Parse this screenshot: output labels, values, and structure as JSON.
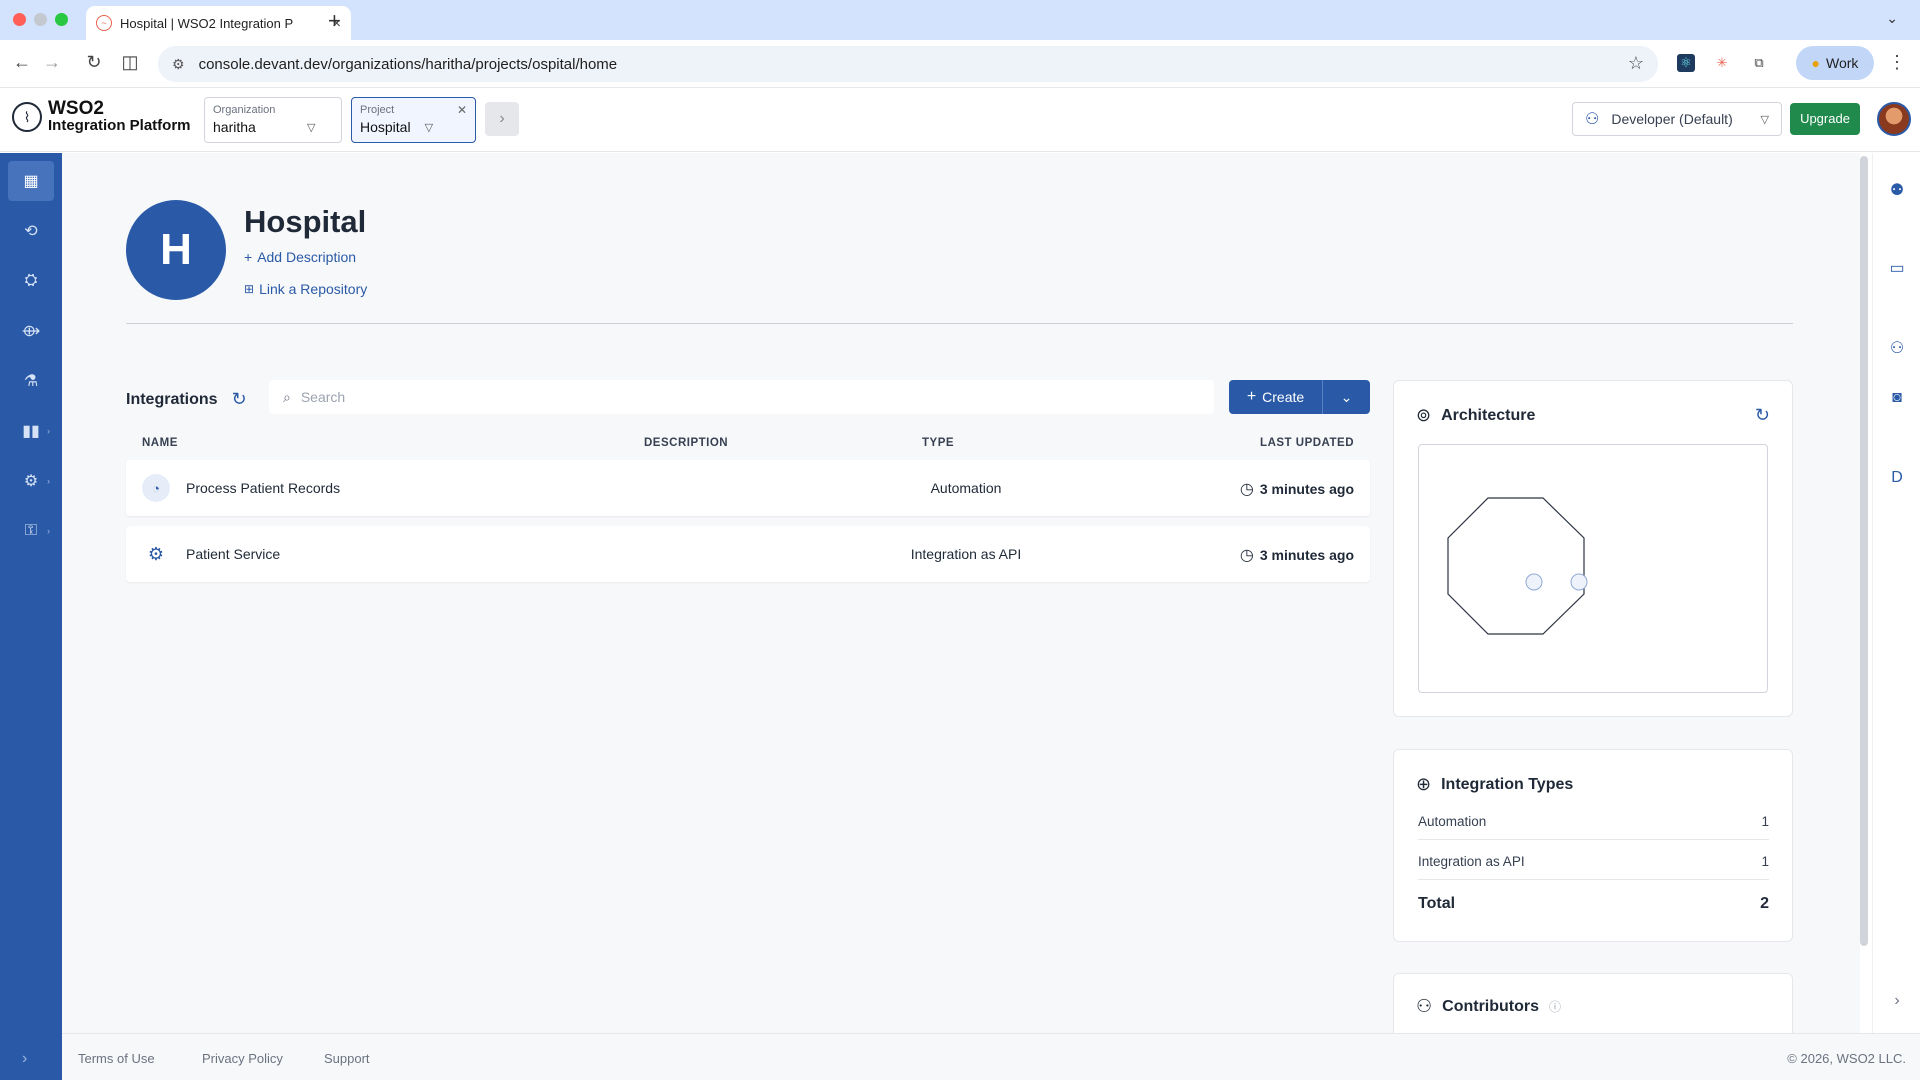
{
  "browser": {
    "tab_title": "Hospital | WSO2 Integration P",
    "url": "console.devant.dev/organizations/haritha/projects/ospital/home",
    "profile_label": "Work"
  },
  "header": {
    "logo_line1": "WSO2",
    "logo_line2": "Integration Platform",
    "org_label": "Organization",
    "org_value": "haritha",
    "project_label": "Project",
    "project_value": "Hospital",
    "environment": "Developer (Default)",
    "upgrade_label": "Upgrade"
  },
  "project": {
    "initial": "H",
    "title": "Hospital",
    "add_description": "Add Description",
    "link_repository": "Link a Repository"
  },
  "integrations": {
    "label": "Integrations",
    "search_placeholder": "Search",
    "create_label": "Create",
    "columns": [
      "NAME",
      "DESCRIPTION",
      "TYPE",
      "LAST UPDATED"
    ],
    "rows": [
      {
        "name": "Process Patient Records",
        "description": "",
        "type": "Automation",
        "updated": "3 minutes ago"
      },
      {
        "name": "Patient Service",
        "description": "",
        "type": "Integration as API",
        "updated": "3 minutes ago"
      }
    ]
  },
  "architecture": {
    "title": "Architecture"
  },
  "integration_types": {
    "title": "Integration Types",
    "rows": [
      {
        "label": "Automation",
        "count": "1"
      },
      {
        "label": "Integration as API",
        "count": "1"
      }
    ],
    "total_label": "Total",
    "total_count": "2"
  },
  "contributors": {
    "title": "Contributors"
  },
  "footer": {
    "terms": "Terms of Use",
    "privacy": "Privacy Policy",
    "support": "Support",
    "copyright": "© 2026, WSO2 LLC."
  },
  "colors": {
    "primary": "#2a5aa7",
    "upgrade": "#1f8a4c"
  }
}
